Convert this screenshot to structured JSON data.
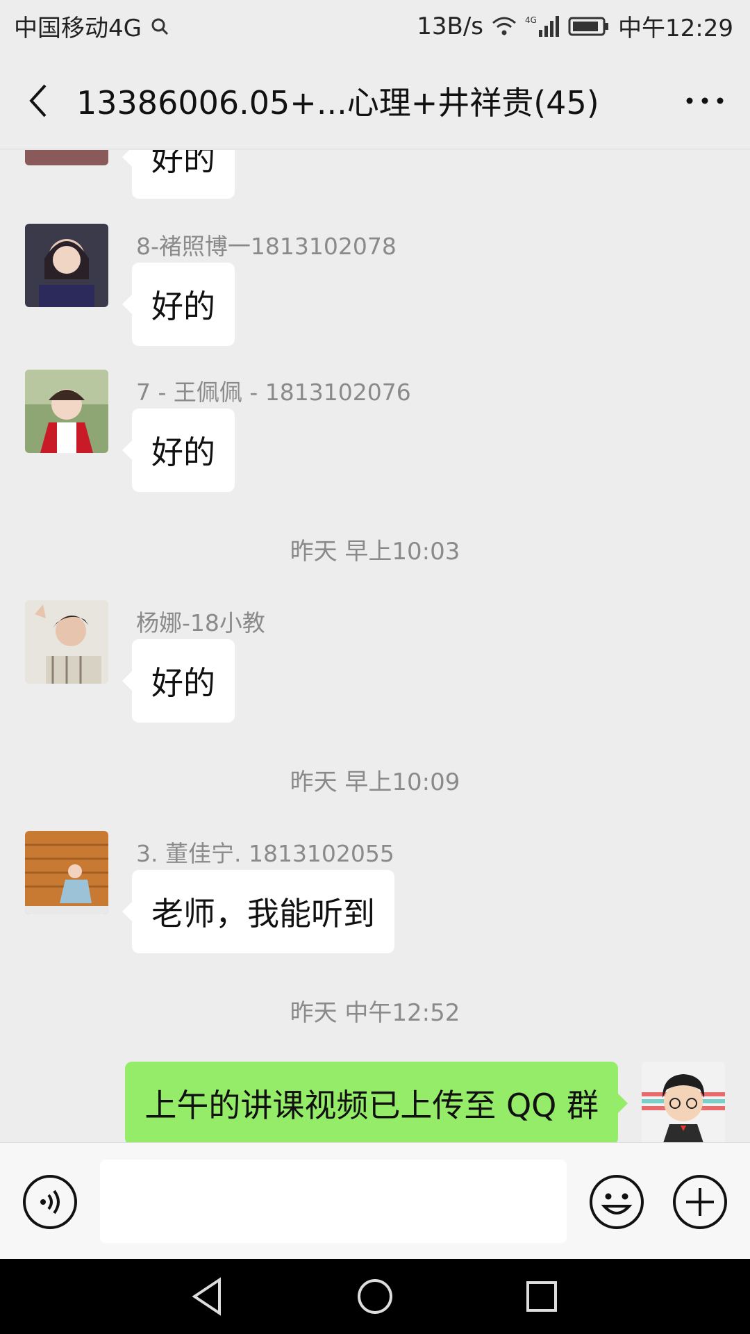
{
  "status_bar": {
    "carrier": "中国移动4G",
    "net_speed": "13B/s",
    "network_type": "4G",
    "time": "中午12:29"
  },
  "header": {
    "title": "13386006.05+...心理+井祥贵(45)"
  },
  "messages": [
    {
      "sender": "",
      "text": "好的"
    },
    {
      "sender": "8-褚照博一1813102078",
      "text": "好的"
    },
    {
      "sender": "7 - 王佩佩 - 1813102076",
      "text": "好的"
    },
    {
      "timestamp": "昨天 早上10:03"
    },
    {
      "sender": "杨娜-18小教",
      "text": "好的"
    },
    {
      "timestamp": "昨天 早上10:09"
    },
    {
      "sender": "3. 董佳宁. 1813102055",
      "text": "老师，我能听到"
    },
    {
      "timestamp": "昨天 中午12:52"
    },
    {
      "sender": "",
      "text": "上午的讲课视频已上传至 QQ 群",
      "mine": true
    }
  ],
  "input": {
    "placeholder": ""
  },
  "icons": {
    "back": "chevron-left-icon",
    "more": "more-dots-icon",
    "voice": "voice-icon",
    "emoji": "emoji-icon",
    "plus": "plus-icon"
  },
  "colors": {
    "background": "#ededed",
    "own_bubble": "#95ec69",
    "other_bubble": "#ffffff",
    "meta_text": "#8a8a8a"
  }
}
